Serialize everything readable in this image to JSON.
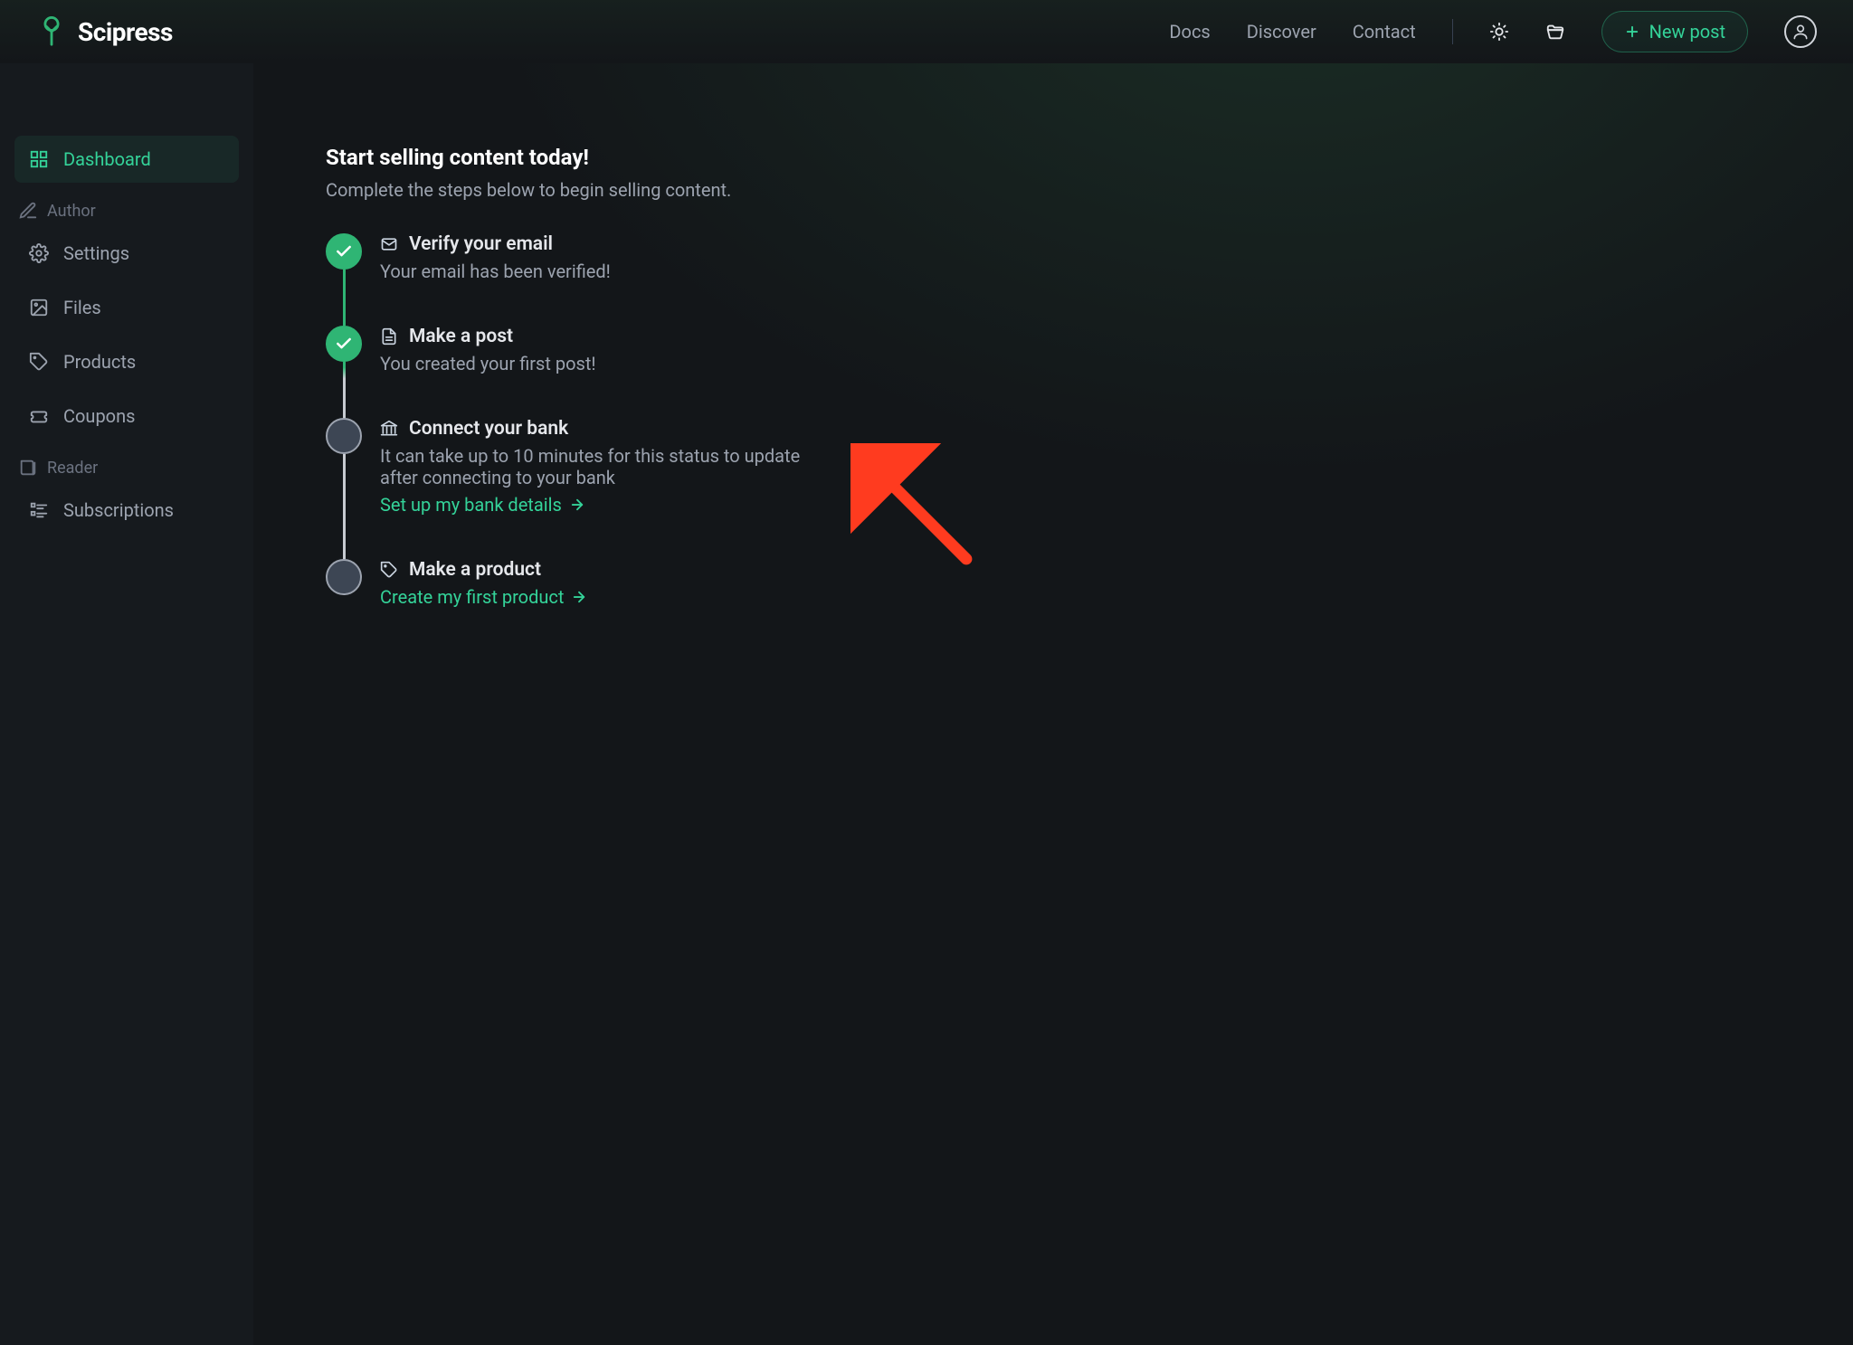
{
  "brand": {
    "name": "Scipress"
  },
  "header": {
    "nav": {
      "docs": "Docs",
      "discover": "Discover",
      "contact": "Contact"
    },
    "new_post": "New post"
  },
  "sidebar": {
    "items": [
      {
        "label": "Dashboard"
      },
      {
        "label": "Settings"
      },
      {
        "label": "Files"
      },
      {
        "label": "Products"
      },
      {
        "label": "Coupons"
      },
      {
        "label": "Subscriptions"
      }
    ],
    "sections": {
      "author": "Author",
      "reader": "Reader"
    }
  },
  "main": {
    "title": "Start selling content today!",
    "subtitle": "Complete the steps below to begin selling content.",
    "steps": [
      {
        "title": "Verify your email",
        "desc": "Your email has been verified!"
      },
      {
        "title": "Make a post",
        "desc": "You created your first post!"
      },
      {
        "title": "Connect your bank",
        "desc": "It can take up to 10 minutes for this status to update after connecting to your bank",
        "link": "Set up my bank details"
      },
      {
        "title": "Make a product",
        "link": "Create my first product"
      }
    ]
  }
}
